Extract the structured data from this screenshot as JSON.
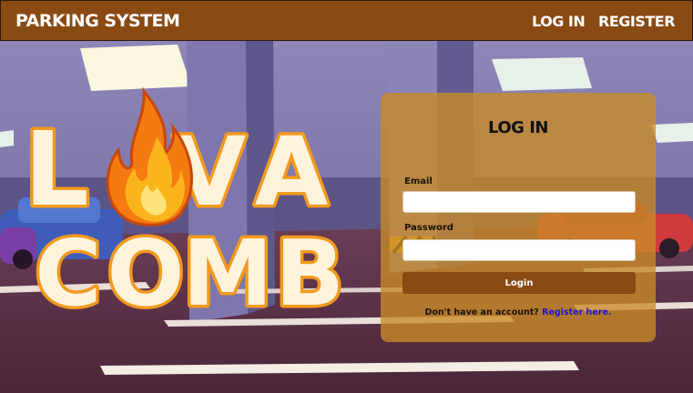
{
  "navbar": {
    "brand": "PARKING SYSTEM",
    "links": [
      {
        "label": "LOG IN"
      },
      {
        "label": "REGISTER"
      }
    ]
  },
  "logo": {
    "line1": [
      "L",
      "V",
      "A"
    ],
    "line2": [
      "C",
      "O",
      "M",
      "B"
    ],
    "text": "LAVA COMB"
  },
  "login": {
    "title": "LOG IN",
    "email_label": "Email",
    "email_value": "",
    "password_label": "Password",
    "password_value": "",
    "button_label": "Login",
    "footer_text": "Don't have an account?",
    "register_link": "Register here."
  },
  "colors": {
    "navbar": "#8a4a14",
    "panel": "#cb8c26",
    "button": "#8a4a14",
    "link": "#1d14d6",
    "logo_fill": "#fff3dc",
    "logo_stroke": "#f29a1e"
  },
  "icons": [
    "fire-icon"
  ]
}
